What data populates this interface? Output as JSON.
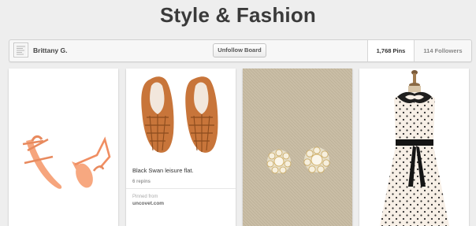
{
  "board": {
    "title": "Style & Fashion"
  },
  "owner": {
    "name": "Brittany G."
  },
  "actions": {
    "unfollow_label": "Unfollow Board"
  },
  "stats": {
    "pins": "1,768 Pins",
    "followers": "114 Followers"
  },
  "pins": [
    {
      "image": "coral-sandals"
    },
    {
      "image": "woven-leather-flats",
      "description": "Black Swan leisure flat.",
      "repins": "6 repins",
      "source_label": "Pinned from",
      "source_domain": "uncovet.com"
    },
    {
      "image": "pearl-cluster-earrings"
    },
    {
      "image": "polka-dot-dress-on-form"
    }
  ]
}
